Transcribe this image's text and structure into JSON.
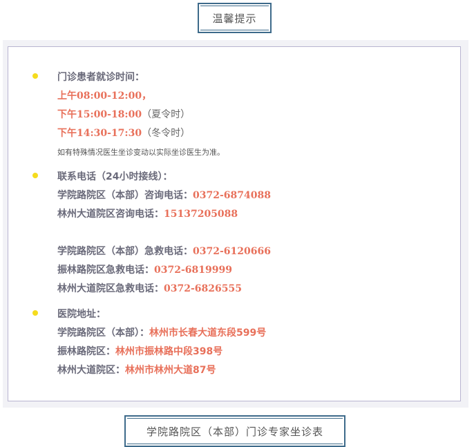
{
  "header_box": {
    "label": "温馨提示"
  },
  "footer_box": {
    "label": "学院路院区（本部）门诊专家坐诊表"
  },
  "hours": {
    "heading": "门诊患者就诊时间：",
    "morning": "上午08:00-12:00，",
    "summer_time": "下午15:00-18:00",
    "summer_note": "（夏令时）",
    "winter_time": "下午14:30-17:30",
    "winter_note": "（冬令时）",
    "notice": "如有特殊情况医生坐诊变动以实际坐诊医生为准。"
  },
  "phones": {
    "heading": "联系电话（24小时接线）：",
    "consult": [
      {
        "label": "学院路院区（本部）咨询电话：",
        "number": "0372-6874088"
      },
      {
        "label": "林州大道院区咨询电话：",
        "number": "15137205088"
      }
    ],
    "emergency": [
      {
        "label": "学院路院区（本部）急救电话：",
        "number": "0372-6120666"
      },
      {
        "label": "振林路院区急救电话：",
        "number": "0372-6819999"
      },
      {
        "label": "林州大道院区急救电话：",
        "number": "0372-6826555"
      }
    ]
  },
  "address": {
    "heading": "医院地址：",
    "items": [
      {
        "label": "学院路院区（本部）：",
        "value": "林州市长春大道东段599号"
      },
      {
        "label": "振林路院区：",
        "value": "林州市振林路中段398号"
      },
      {
        "label": "林州大道院区：",
        "value": "林州市林州大道87号"
      }
    ]
  },
  "colors": {
    "accent_red": "#e8705a",
    "bullet_yellow": "#f5dc1e",
    "frame_blue": "#3d6a8a"
  }
}
